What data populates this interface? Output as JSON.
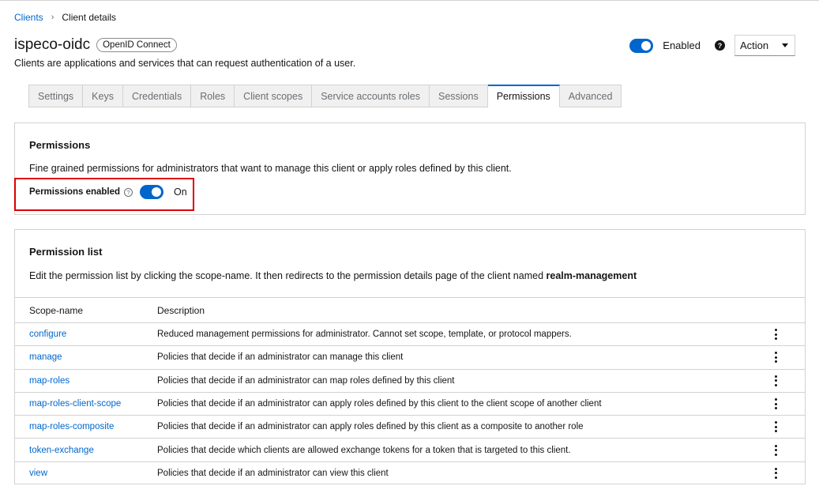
{
  "breadcrumb": {
    "parent": "Clients",
    "current": "Client details"
  },
  "header": {
    "title": "ispeco-oidc",
    "badge": "OpenID Connect",
    "subtitle": "Clients are applications and services that can request authentication of a user.",
    "enabled_label": "Enabled",
    "enabled": true,
    "action_label": "Action"
  },
  "tabs": [
    {
      "label": "Settings"
    },
    {
      "label": "Keys"
    },
    {
      "label": "Credentials"
    },
    {
      "label": "Roles"
    },
    {
      "label": "Client scopes"
    },
    {
      "label": "Service accounts roles"
    },
    {
      "label": "Sessions"
    },
    {
      "label": "Permissions",
      "active": true
    },
    {
      "label": "Advanced"
    }
  ],
  "permissions": {
    "title": "Permissions",
    "description": "Fine grained permissions for administrators that want to manage this client or apply roles defined by this client.",
    "toggle_label": "Permissions enabled",
    "toggle_state": "On"
  },
  "permission_list": {
    "title": "Permission list",
    "description_prefix": "Edit the permission list by clicking the scope-name. It then redirects to the permission details page of the client named ",
    "description_client": "realm-management",
    "columns": [
      "Scope-name",
      "Description"
    ],
    "rows": [
      {
        "name": "configure",
        "description": "Reduced management permissions for administrator. Cannot set scope, template, or protocol mappers."
      },
      {
        "name": "manage",
        "description": "Policies that decide if an administrator can manage this client"
      },
      {
        "name": "map-roles",
        "description": "Policies that decide if an administrator can map roles defined by this client"
      },
      {
        "name": "map-roles-client-scope",
        "description": "Policies that decide if an administrator can apply roles defined by this client to the client scope of another client"
      },
      {
        "name": "map-roles-composite",
        "description": "Policies that decide if an administrator can apply roles defined by this client as a composite to another role"
      },
      {
        "name": "token-exchange",
        "description": "Policies that decide which clients are allowed exchange tokens for a token that is targeted to this client."
      },
      {
        "name": "view",
        "description": "Policies that decide if an administrator can view this client"
      }
    ]
  },
  "colors": {
    "accent": "#0066cc",
    "highlight": "#e00000"
  }
}
